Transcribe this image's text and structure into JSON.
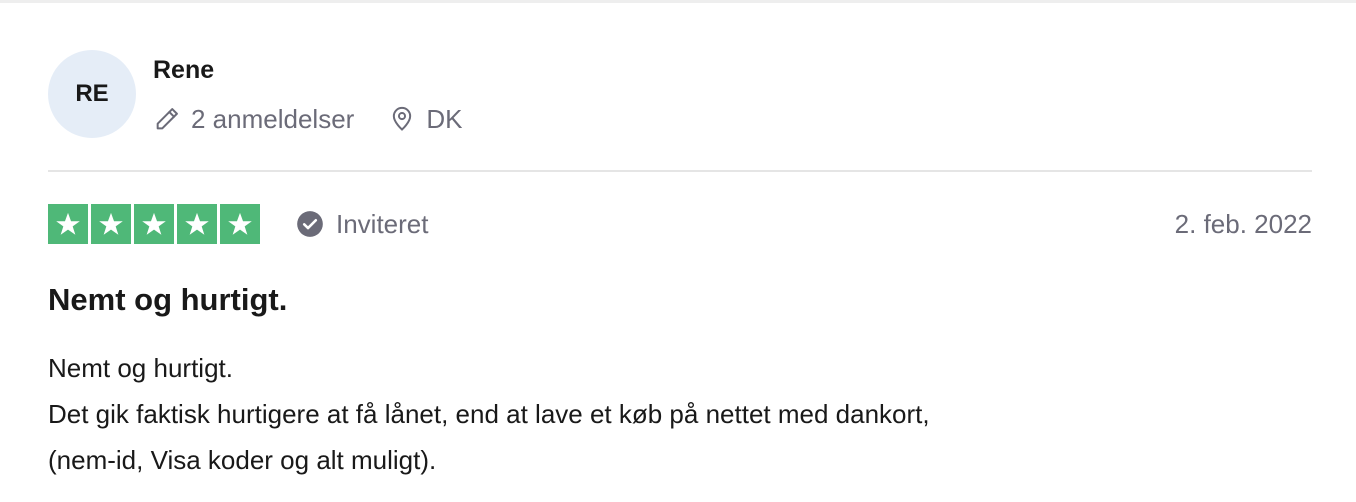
{
  "review": {
    "author": {
      "initials": "RE",
      "name": "Rene",
      "review_count": "2 anmeldelser",
      "country": "DK"
    },
    "rating": 5,
    "rating_color": "#4fb878",
    "verification_label": "Inviteret",
    "date": "2. feb. 2022",
    "title": "Nemt og hurtigt.",
    "body_lines": [
      "Nemt og hurtigt.",
      "Det gik faktisk hurtigere at få lånet, end at lave et køb på nettet med dankort,",
      "(nem-id, Visa koder og alt muligt)."
    ],
    "icons": {
      "review_count": "pencil-icon",
      "country": "location-pin-icon",
      "verification": "check-circle-icon",
      "rating": "star-icon"
    }
  }
}
